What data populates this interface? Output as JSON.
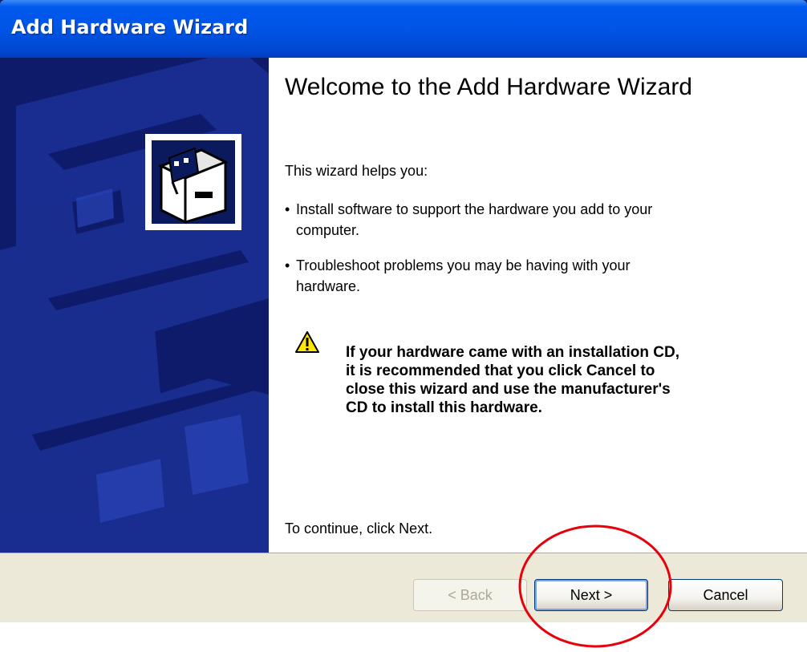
{
  "window": {
    "title": "Add Hardware Wizard"
  },
  "content": {
    "heading": "Welcome to the Add Hardware Wizard",
    "intro": "This wizard helps you:",
    "bullets": [
      {
        "marker": "•",
        "lines": [
          "Install software to support the hardware you add to your",
          "computer."
        ]
      },
      {
        "marker": "•",
        "lines": [
          "Troubleshoot problems you may be having with your",
          "hardware."
        ]
      }
    ],
    "warning_lines": [
      "If your hardware came with an installation CD,",
      "it is recommended that you click Cancel to",
      "close this wizard and use the manufacturer's",
      "CD to install this hardware."
    ],
    "continue_text": "To continue, click Next."
  },
  "footer": {
    "back_label": "< Back",
    "next_label": "Next >",
    "cancel_label": "Cancel"
  },
  "icons": {
    "hardware_icon": "hardware-card-icon",
    "warning_icon": "warning-triangle-icon"
  },
  "colors": {
    "title_bar": "#0054e3",
    "side_panel": "#0e1b6b",
    "footer": "#ece9d8",
    "annotation_circle": "#e8000b"
  }
}
